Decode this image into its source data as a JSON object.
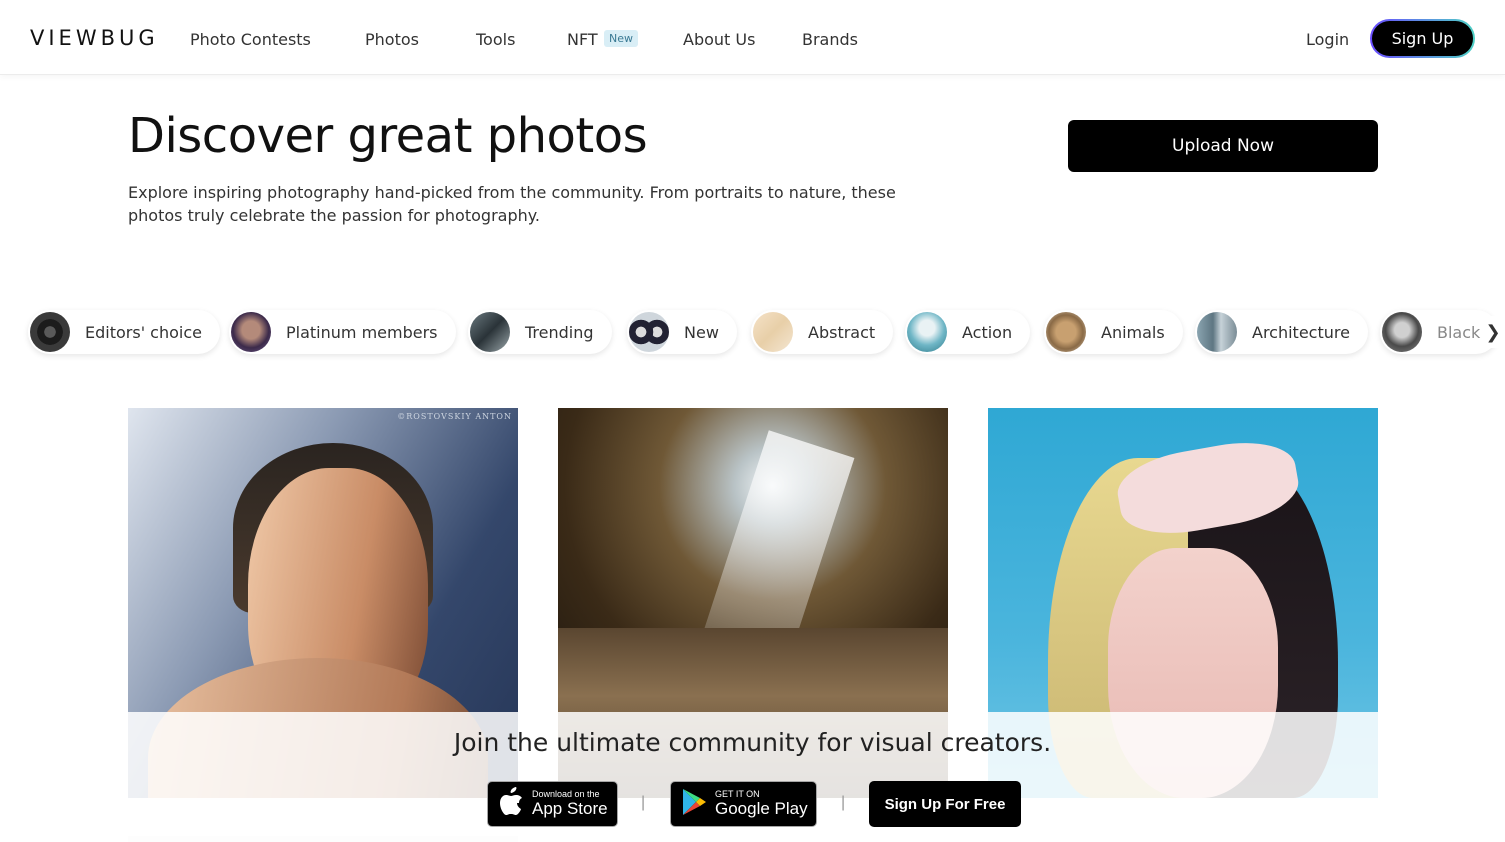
{
  "header": {
    "logo": "VIEWBUG",
    "nav": [
      "Photo Contests",
      "Photos",
      "Tools",
      "NFT",
      "About Us",
      "Brands"
    ],
    "nft_badge": "New",
    "login": "Login",
    "signup": "Sign Up"
  },
  "hero": {
    "title": "Discover great photos",
    "description": "Explore inspiring photography hand-picked from the community. From portraits to nature, these photos truly celebrate the passion for photography.",
    "upload": "Upload Now"
  },
  "categories": [
    "Editors' choice",
    "Platinum members",
    "Trending",
    "New",
    "Abstract",
    "Action",
    "Animals",
    "Architecture",
    "Black"
  ],
  "photos": {
    "watermark": "©ROSTOVSKIY ANTON"
  },
  "join": {
    "title": "Join the ultimate community for visual creators.",
    "appstore_small": "Download on the",
    "appstore_big": "App Store",
    "gplay_small": "GET IT ON",
    "gplay_big": "Google Play",
    "separator": "|",
    "signup_free": "Sign Up For Free"
  }
}
